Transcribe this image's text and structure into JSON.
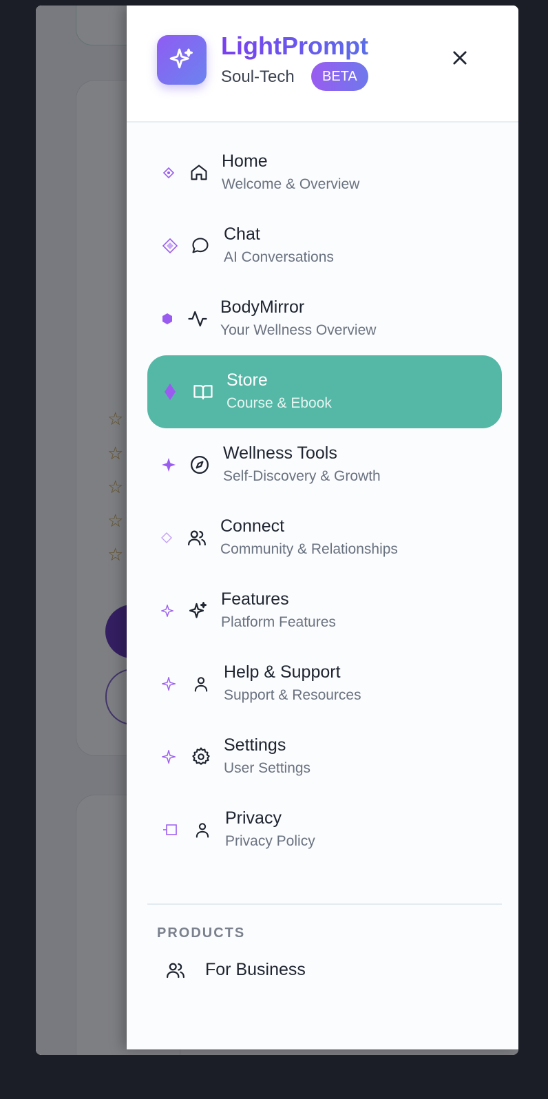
{
  "app": {
    "name": "LightPrompt",
    "subtitle": "Soul-Tech",
    "badge": "BETA",
    "accent_colors": {
      "brand_gradient_start": "#8f5cf2",
      "brand_gradient_end": "#6b83f0",
      "active_item": "#55b7a6"
    }
  },
  "nav": {
    "items": [
      {
        "title": "Home",
        "subtitle": "Welcome & Overview",
        "icon": "home-icon"
      },
      {
        "title": "Chat",
        "subtitle": "AI Conversations",
        "icon": "chat-bubble-icon"
      },
      {
        "title": "BodyMirror",
        "subtitle": "Your Wellness Overview",
        "icon": "activity-pulse-icon"
      },
      {
        "title": "Store",
        "subtitle": "Course & Ebook",
        "icon": "book-open-icon",
        "active": true
      },
      {
        "title": "Wellness Tools",
        "subtitle": "Self-Discovery & Growth",
        "icon": "compass-icon"
      },
      {
        "title": "Connect",
        "subtitle": "Community & Relationships",
        "icon": "users-icon"
      },
      {
        "title": "Features",
        "subtitle": "Platform Features",
        "icon": "sparkles-icon"
      },
      {
        "title": "Help & Support",
        "subtitle": "Support & Resources",
        "icon": "user-icon"
      },
      {
        "title": "Settings",
        "subtitle": "User Settings",
        "icon": "gear-icon"
      },
      {
        "title": "Privacy",
        "subtitle": "Privacy Policy",
        "icon": "user-icon"
      }
    ]
  },
  "products": {
    "label": "PRODUCTS",
    "items": [
      {
        "label": "For Business",
        "icon": "users-icon"
      }
    ]
  }
}
